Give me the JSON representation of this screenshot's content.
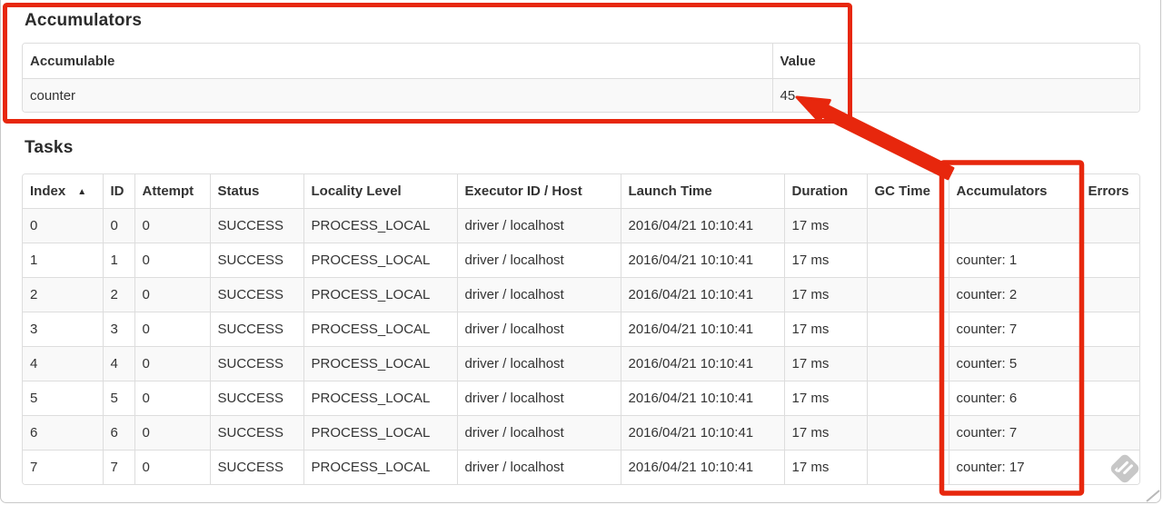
{
  "annotation_color": "#e7270d",
  "accumulators": {
    "title": "Accumulators",
    "table": {
      "headers": [
        "Accumulable",
        "Value"
      ],
      "rows": [
        [
          "counter",
          "45"
        ]
      ]
    }
  },
  "tasks": {
    "title": "Tasks",
    "table": {
      "sort_indicator": "▲",
      "headers": [
        {
          "id": "index",
          "label": "Index"
        },
        {
          "id": "id",
          "label": "ID"
        },
        {
          "id": "attempt",
          "label": "Attempt"
        },
        {
          "id": "status",
          "label": "Status"
        },
        {
          "id": "locality_level",
          "label": "Locality Level"
        },
        {
          "id": "executor_id_host",
          "label": "Executor ID / Host"
        },
        {
          "id": "launch_time",
          "label": "Launch Time"
        },
        {
          "id": "duration",
          "label": "Duration"
        },
        {
          "id": "gc_time",
          "label": "GC Time"
        },
        {
          "id": "accumulators",
          "label": "Accumulators"
        },
        {
          "id": "errors",
          "label": "Errors"
        }
      ],
      "rows": [
        {
          "index": "0",
          "id": "0",
          "attempt": "0",
          "status": "SUCCESS",
          "locality_level": "PROCESS_LOCAL",
          "executor_id_host": "driver / localhost",
          "launch_time": "2016/04/21 10:10:41",
          "duration": "17 ms",
          "gc_time": "",
          "accumulators": "",
          "errors": ""
        },
        {
          "index": "1",
          "id": "1",
          "attempt": "0",
          "status": "SUCCESS",
          "locality_level": "PROCESS_LOCAL",
          "executor_id_host": "driver / localhost",
          "launch_time": "2016/04/21 10:10:41",
          "duration": "17 ms",
          "gc_time": "",
          "accumulators": "counter: 1",
          "errors": ""
        },
        {
          "index": "2",
          "id": "2",
          "attempt": "0",
          "status": "SUCCESS",
          "locality_level": "PROCESS_LOCAL",
          "executor_id_host": "driver / localhost",
          "launch_time": "2016/04/21 10:10:41",
          "duration": "17 ms",
          "gc_time": "",
          "accumulators": "counter: 2",
          "errors": ""
        },
        {
          "index": "3",
          "id": "3",
          "attempt": "0",
          "status": "SUCCESS",
          "locality_level": "PROCESS_LOCAL",
          "executor_id_host": "driver / localhost",
          "launch_time": "2016/04/21 10:10:41",
          "duration": "17 ms",
          "gc_time": "",
          "accumulators": "counter: 7",
          "errors": ""
        },
        {
          "index": "4",
          "id": "4",
          "attempt": "0",
          "status": "SUCCESS",
          "locality_level": "PROCESS_LOCAL",
          "executor_id_host": "driver / localhost",
          "launch_time": "2016/04/21 10:10:41",
          "duration": "17 ms",
          "gc_time": "",
          "accumulators": "counter: 5",
          "errors": ""
        },
        {
          "index": "5",
          "id": "5",
          "attempt": "0",
          "status": "SUCCESS",
          "locality_level": "PROCESS_LOCAL",
          "executor_id_host": "driver / localhost",
          "launch_time": "2016/04/21 10:10:41",
          "duration": "17 ms",
          "gc_time": "",
          "accumulators": "counter: 6",
          "errors": ""
        },
        {
          "index": "6",
          "id": "6",
          "attempt": "0",
          "status": "SUCCESS",
          "locality_level": "PROCESS_LOCAL",
          "executor_id_host": "driver / localhost",
          "launch_time": "2016/04/21 10:10:41",
          "duration": "17 ms",
          "gc_time": "",
          "accumulators": "counter: 7",
          "errors": ""
        },
        {
          "index": "7",
          "id": "7",
          "attempt": "0",
          "status": "SUCCESS",
          "locality_level": "PROCESS_LOCAL",
          "executor_id_host": "driver / localhost",
          "launch_time": "2016/04/21 10:10:41",
          "duration": "17 ms",
          "gc_time": "",
          "accumulators": "counter: 17",
          "errors": ""
        }
      ]
    }
  },
  "watermark_icon": "skitch-diamond-pencil"
}
